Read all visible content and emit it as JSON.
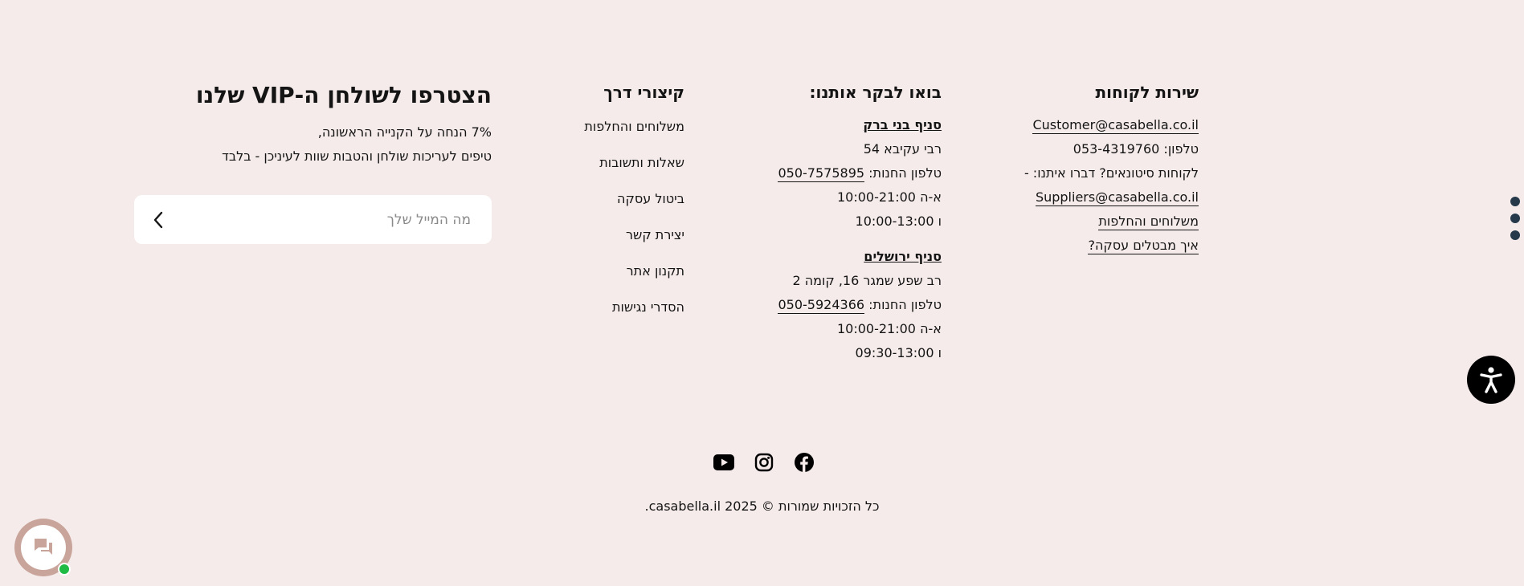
{
  "service": {
    "title": "שירות לקוחות",
    "email": "Customer@casabella.co.il",
    "phone_line": "טלפון: 053-4319760",
    "wholesale_line": "לקוחות סיטונאים? דברו איתנו: -",
    "supplier_email": "Suppliers@casabella.co.il",
    "shipping_link": "משלוחים והחלפות",
    "cancel_link": "איך מבטלים עסקה?"
  },
  "visit": {
    "title": "בואו לבקר אותנו:",
    "branch1": {
      "name": "סניף בני ברק",
      "address": "רבי עקיבא 54",
      "phone_label": "טלפון החנות:",
      "phone": "050-7575895",
      "hours_weekday": "א-ה 10:00-21:00",
      "hours_friday": "ו 10:00-13:00"
    },
    "branch2": {
      "name": "סניף ירושלים",
      "address": "רב שפע שמגר 16, קומה 2",
      "phone_label": "טלפון החנות:",
      "phone": "050-5924366",
      "hours_weekday": "א-ה 10:00-21:00",
      "hours_friday": "ו 09:30-13:00"
    }
  },
  "shortcuts": {
    "title": "קיצורי דרך",
    "items": [
      "משלוחים והחלפות",
      "שאלות ותשובות",
      "ביטול עסקה",
      "יצירת קשר",
      "תקנון אתר",
      "הסדרי נגישות"
    ]
  },
  "vip": {
    "title": "הצטרפו לשולחן ה-VIP שלנו",
    "line1": "7% הנחה על הקנייה הראשונה,",
    "line2": "טיפים לעריכות שולחן והטבות שוות לעיניכן - בלבד",
    "email_placeholder": "מה המייל שלך"
  },
  "footer": {
    "copyright": "כל הזכויות שמורות © 2025 casabella.il."
  },
  "icons": {
    "social": [
      "youtube-icon",
      "instagram-icon",
      "facebook-icon"
    ],
    "accessibility": "accessibility-icon",
    "chat": "chat-icon"
  },
  "colors": {
    "background": "#f5ebea",
    "text": "#141414",
    "dots": "#25394a",
    "chat_ring": "#c9a49a",
    "online": "#1fbb44"
  }
}
